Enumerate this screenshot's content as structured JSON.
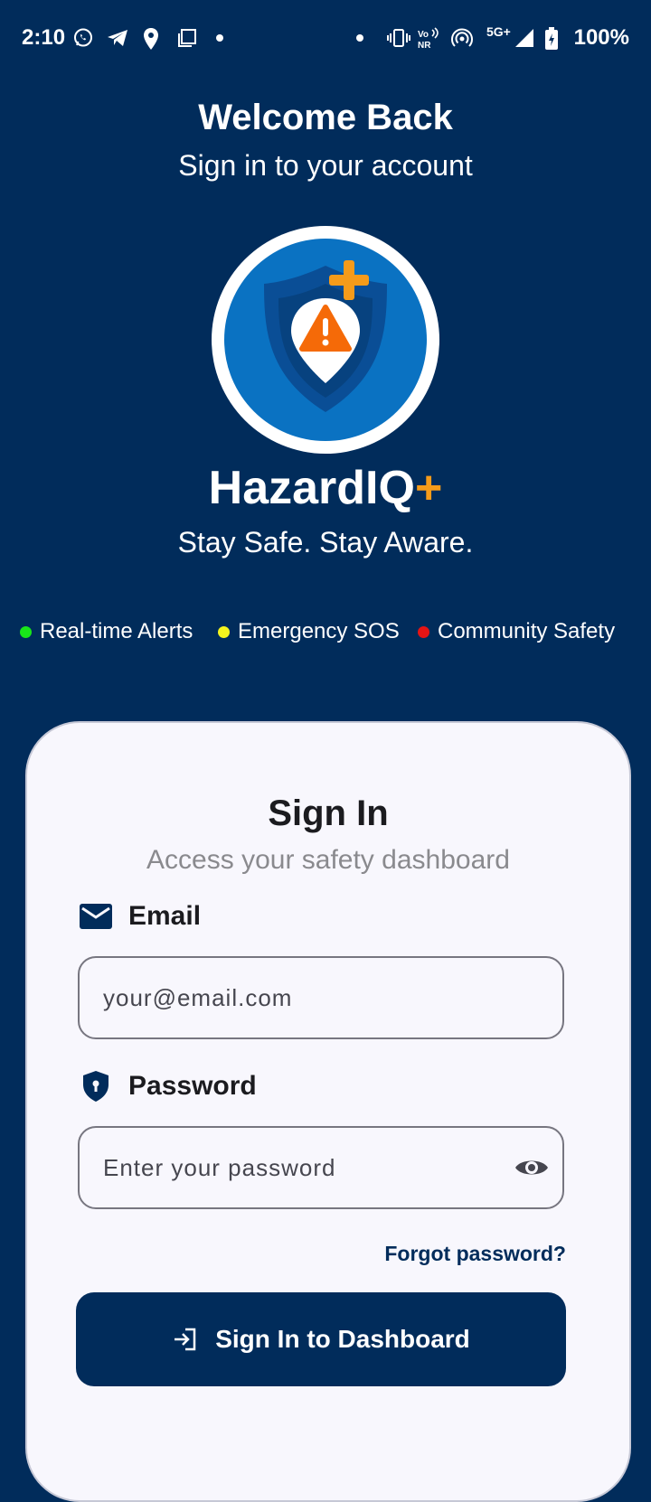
{
  "status_bar": {
    "time": "2:10",
    "battery": "100%",
    "network": "5G+",
    "icons": [
      "whatsapp-icon",
      "telegram-icon",
      "location-icon",
      "copy-icon",
      "dot-icon",
      "dot-icon",
      "vibrate-icon",
      "volte-nr-icon",
      "hotspot-icon",
      "signal-icon",
      "battery-charging-icon"
    ]
  },
  "header": {
    "title": "Welcome Back",
    "subtitle": "Sign in to your account"
  },
  "brand": {
    "name": "HazardIQ",
    "plus": "+",
    "tagline": "Stay Safe. Stay Aware.",
    "logo_icon": "shield-warning-location-icon",
    "accent_color": "#f59b1a"
  },
  "features": [
    {
      "label": "Real-time Alerts",
      "color": "#19e619"
    },
    {
      "label": "Emergency SOS",
      "color": "#f5f51e"
    },
    {
      "label": "Community Safety",
      "color": "#e61414"
    }
  ],
  "card": {
    "title": "Sign In",
    "subtitle": "Access your safety dashboard",
    "email": {
      "label": "Email",
      "placeholder": "your@email.com",
      "value": "",
      "icon": "mail-icon"
    },
    "password": {
      "label": "Password",
      "placeholder": "Enter your password",
      "value": "",
      "icon": "shield-lock-icon",
      "toggle_icon": "eye-icon"
    },
    "forgot_label": "Forgot password?",
    "submit_label": "Sign In to Dashboard",
    "submit_icon": "login-icon"
  },
  "colors": {
    "background": "#012c5b",
    "card": "#f8f7fd",
    "primary": "#012c5b"
  }
}
